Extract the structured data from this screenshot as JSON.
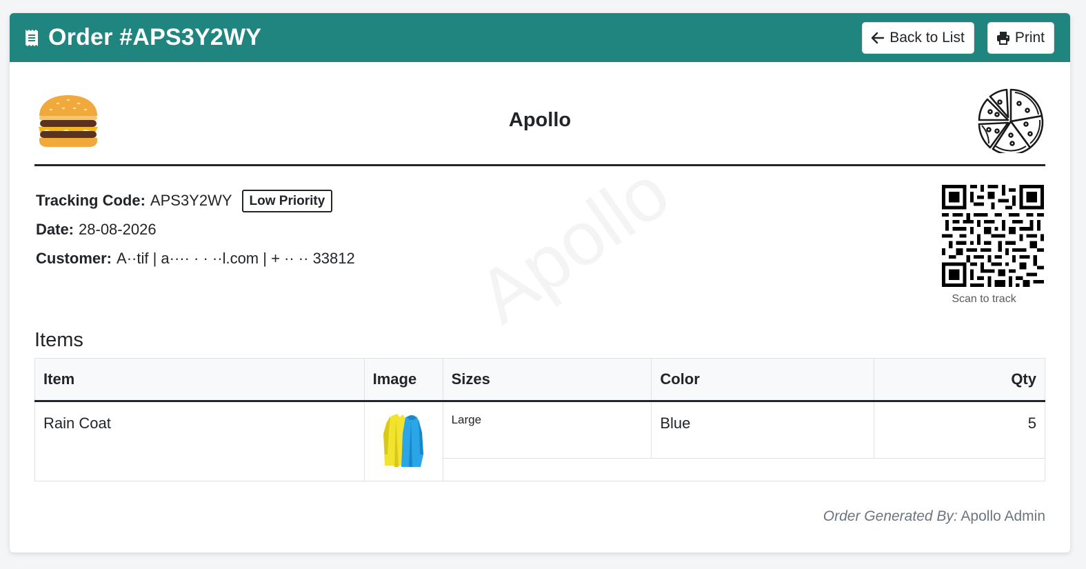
{
  "header": {
    "title": "Order #APS3Y2WY",
    "back_label": "Back to List",
    "print_label": "Print"
  },
  "brand": {
    "name": "Apollo",
    "watermark": "Apollo"
  },
  "order": {
    "tracking_label": "Tracking Code:",
    "tracking_code": "APS3Y2WY",
    "priority": "Low Priority",
    "date_label": "Date:",
    "date": "28-08-2026",
    "customer_label": "Customer:",
    "customer": "A··tif | a···· · · ··l.com | + ·· ·· 33812"
  },
  "qr": {
    "caption": "Scan to track"
  },
  "items": {
    "title": "Items",
    "columns": [
      "Item",
      "Image",
      "Sizes",
      "Color",
      "Qty"
    ],
    "rows": [
      {
        "item": "Rain Coat",
        "sizes": "Large",
        "color": "Blue",
        "qty": "5"
      }
    ]
  },
  "footer": {
    "label": "Order Generated By:",
    "author": "Apollo Admin"
  },
  "colors": {
    "header_bg": "#20857f",
    "text": "#212529"
  }
}
